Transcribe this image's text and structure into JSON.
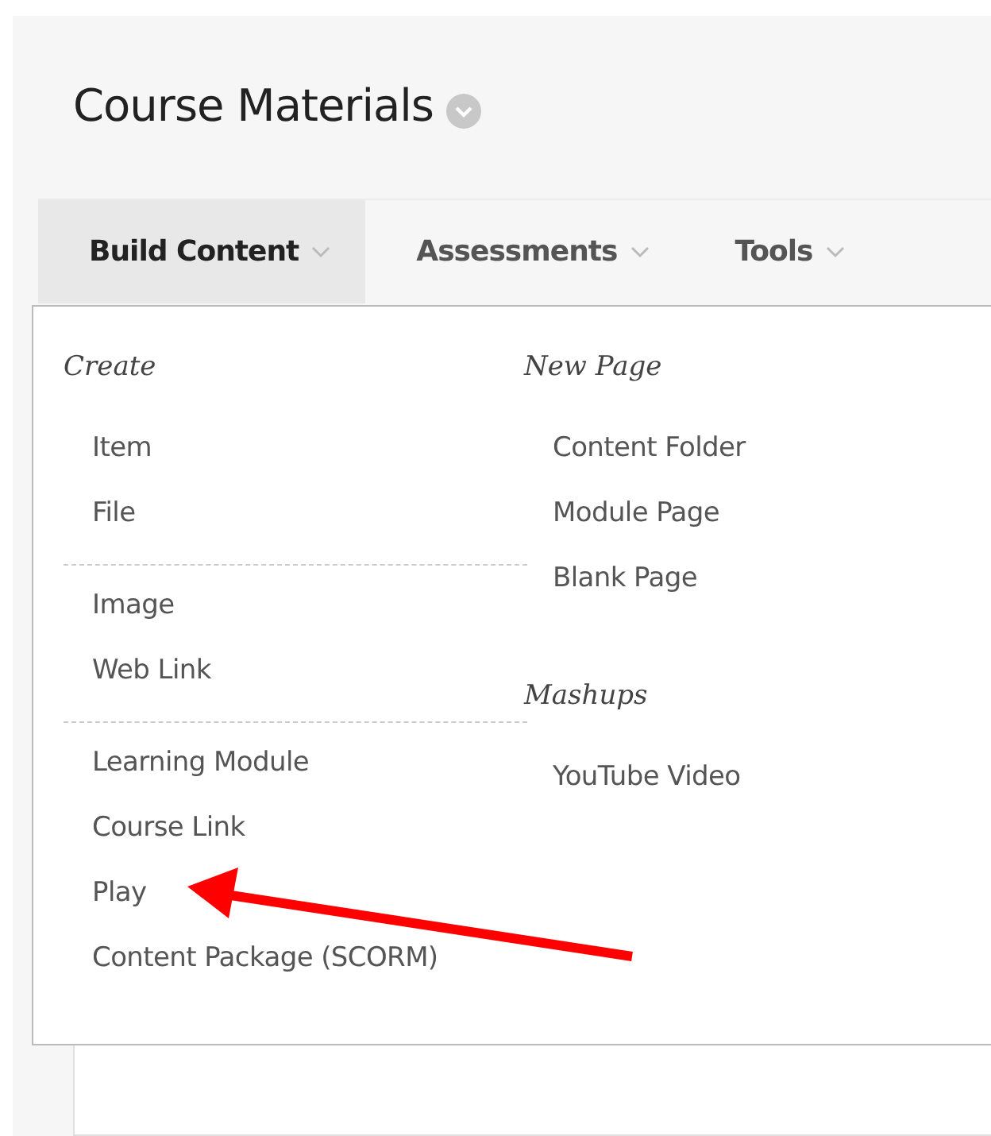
{
  "page_title": "Course Materials",
  "tabs": [
    {
      "label": "Build Content",
      "selected": true
    },
    {
      "label": "Assessments",
      "selected": false
    },
    {
      "label": "Tools",
      "selected": false
    }
  ],
  "menu_columns": [
    {
      "sections": [
        {
          "heading": "Create",
          "groups": [
            [
              "Item",
              "File"
            ],
            [
              "Image",
              "Web Link"
            ],
            [
              "Learning Module",
              "Course Link",
              "Play",
              "Content Package (SCORM)"
            ]
          ]
        }
      ]
    },
    {
      "sections": [
        {
          "heading": "New Page",
          "groups": [
            [
              "Content Folder",
              "Module Page",
              "Blank Page"
            ]
          ]
        },
        {
          "heading": "Mashups",
          "groups": [
            [
              "YouTube Video"
            ]
          ]
        }
      ]
    }
  ]
}
